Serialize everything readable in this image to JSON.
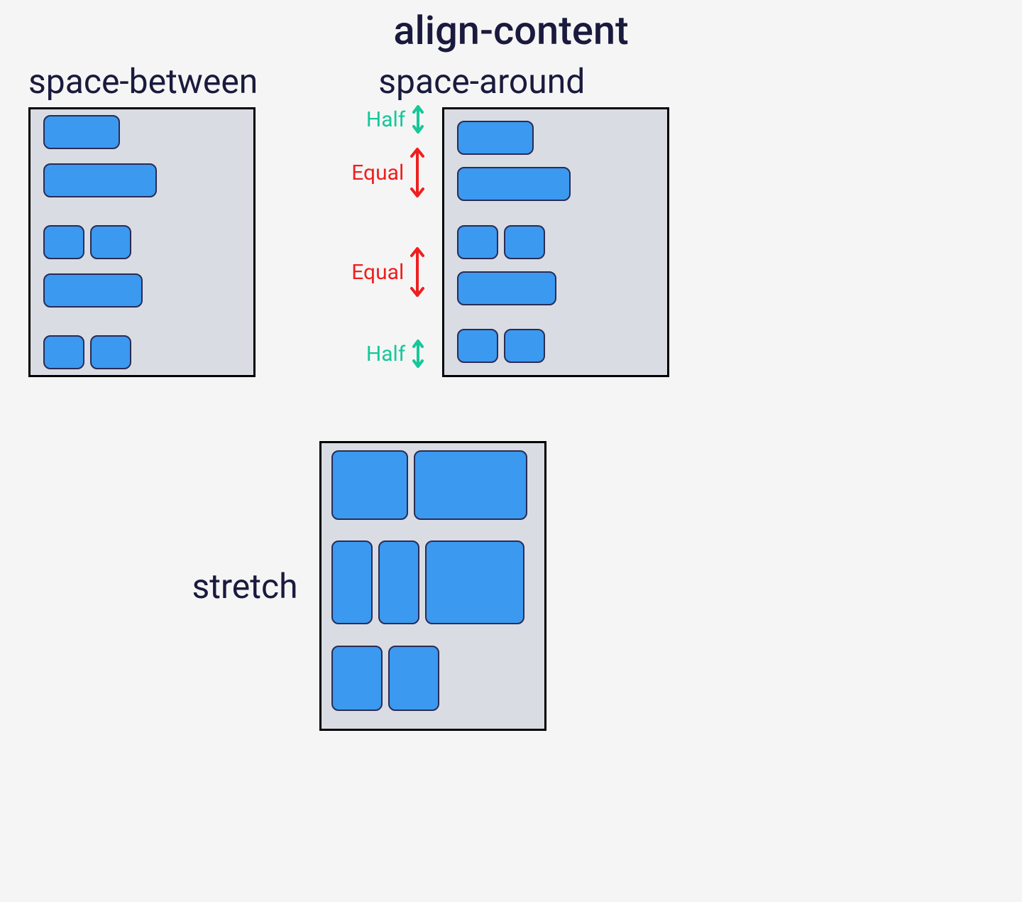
{
  "title": "align-content",
  "examples": {
    "space_between": {
      "label": "space-between"
    },
    "space_around": {
      "label": "space-around"
    },
    "stretch": {
      "label": "stretch"
    }
  },
  "annotations": {
    "half": "Half",
    "equal": "Equal"
  },
  "colors": {
    "item_fill": "#3b99f0",
    "item_stroke": "#2b2b55",
    "container_fill": "#d9dde3",
    "half_color": "#17c79a",
    "equal_color": "#ef1f1f",
    "text": "#1a1a3e"
  },
  "chart_data": {
    "type": "table",
    "title": "CSS align-content property illustrated with three flex containers",
    "property": "align-content",
    "values_shown": [
      "space-between",
      "space-around",
      "stretch"
    ],
    "containers": [
      {
        "value": "space-between",
        "rows": [
          {
            "items": [
              {
                "w": "medium"
              },
              {
                "w": "xlarge"
              }
            ]
          },
          {
            "items": [
              {
                "w": "small"
              },
              {
                "w": "small"
              },
              {
                "w": "large"
              }
            ]
          },
          {
            "items": [
              {
                "w": "small"
              },
              {
                "w": "small"
              }
            ]
          }
        ],
        "spacing_pattern": [
          "edge",
          "equal-gap",
          "equal-gap",
          "edge"
        ]
      },
      {
        "value": "space-around",
        "rows": [
          {
            "items": [
              {
                "w": "medium"
              },
              {
                "w": "xlarge"
              }
            ]
          },
          {
            "items": [
              {
                "w": "small"
              },
              {
                "w": "small"
              },
              {
                "w": "large"
              }
            ]
          },
          {
            "items": [
              {
                "w": "small"
              },
              {
                "w": "small"
              }
            ]
          }
        ],
        "spacing_pattern": [
          "half",
          "equal",
          "equal",
          "half"
        ],
        "annotations": [
          "Half",
          "Equal",
          "Equal",
          "Half"
        ]
      },
      {
        "value": "stretch",
        "rows": [
          {
            "items": [
              {
                "w": "medium"
              },
              {
                "w": "xlarge"
              }
            ],
            "stretched": true
          },
          {
            "items": [
              {
                "w": "small"
              },
              {
                "w": "small"
              },
              {
                "w": "large"
              }
            ],
            "stretched": true
          },
          {
            "items": [
              {
                "w": "small"
              },
              {
                "w": "small"
              }
            ],
            "stretched": true
          }
        ],
        "spacing_pattern": [
          "none (rows fill height)"
        ]
      }
    ]
  }
}
